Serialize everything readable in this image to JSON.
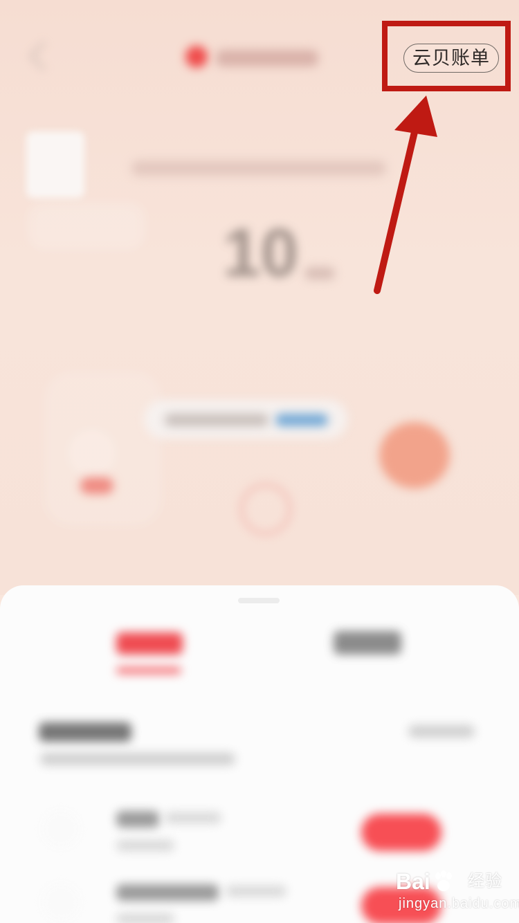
{
  "header": {
    "ledger_button_label": "云贝账单"
  },
  "watermark": {
    "brand": "Bai",
    "product": "经验",
    "domain": "jingyan.baidu.com"
  },
  "annotation": {
    "highlight_color": "#bf1a13",
    "arrow_color": "#bf1a13"
  },
  "background": {
    "number_value": "10"
  }
}
